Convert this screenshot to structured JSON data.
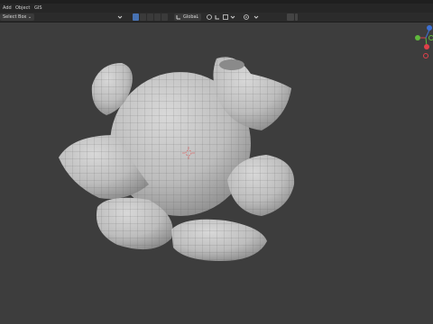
{
  "menubar": {
    "items": [
      "Add",
      "Object",
      "GIS"
    ]
  },
  "header": {
    "select_label": "Select Box",
    "orientation_label": "Global",
    "chevron": "⌄"
  },
  "icons": {
    "transform_pivot": "pivot-icon",
    "snap": "snap-icon",
    "proportional": "proportional-edit-icon",
    "viewport_shading": "shading-icon",
    "gizmo": "navigation-gizmo"
  },
  "colors": {
    "viewport_bg": "#3d3d3d",
    "active_tool": "#4772b3",
    "axis_x": "#e0404a",
    "axis_y": "#5fb83c",
    "axis_z": "#3c70d4",
    "mesh": "#bfbfbf"
  }
}
